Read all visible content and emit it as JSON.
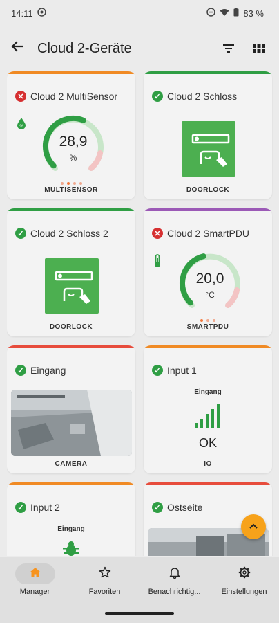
{
  "status_bar": {
    "time": "14:11",
    "battery": "83 %"
  },
  "app_bar": {
    "title": "Cloud 2-Geräte",
    "back_icon": "arrow-back-icon",
    "filter_icon": "filter-icon",
    "grid_icon": "grid-view-icon"
  },
  "cards": [
    {
      "title": "Cloud 2 MultiSensor",
      "status": "error",
      "type_label": "MULTISENSOR",
      "value": "28,9",
      "unit": "%",
      "gauge_fraction": 0.58,
      "accent": "#f08a24"
    },
    {
      "title": "Cloud 2 Schloss",
      "status": "ok",
      "type_label": "DOORLOCK",
      "accent": "#2f9e44"
    },
    {
      "title": "Cloud 2 Schloss 2",
      "status": "ok",
      "type_label": "DOORLOCK",
      "accent": "#2f9e44"
    },
    {
      "title": "Cloud 2 SmartPDU",
      "status": "error",
      "type_label": "SMARTPDU",
      "value": "20,0",
      "unit": "°C",
      "gauge_fraction": 0.45,
      "accent": "#9b59b6"
    },
    {
      "title": "Eingang",
      "status": "ok",
      "type_label": "CAMERA",
      "accent": "#e74c3c"
    },
    {
      "title": "Input 1",
      "status": "ok",
      "type_label": "IO",
      "io_label": "Eingang",
      "io_value": "OK",
      "accent": "#f08a24"
    },
    {
      "title": "Input 2",
      "status": "ok",
      "io_label": "Eingang",
      "accent": "#f08a24"
    },
    {
      "title": "Ostseite",
      "status": "ok",
      "accent": "#e74c3c"
    }
  ],
  "bottom_nav": [
    {
      "label": "Manager",
      "icon": "home-icon",
      "active": true
    },
    {
      "label": "Favoriten",
      "icon": "star-icon",
      "active": false
    },
    {
      "label": "Benachrichtig...",
      "icon": "bell-icon",
      "active": false
    },
    {
      "label": "Einstellungen",
      "icon": "gear-icon",
      "active": false
    }
  ],
  "colors": {
    "ok": "#2f9e44",
    "error": "#d63031",
    "fab": "#f7a21a",
    "gauge_track": "#c8e6c9",
    "gauge_danger": "#f3c4c4"
  }
}
